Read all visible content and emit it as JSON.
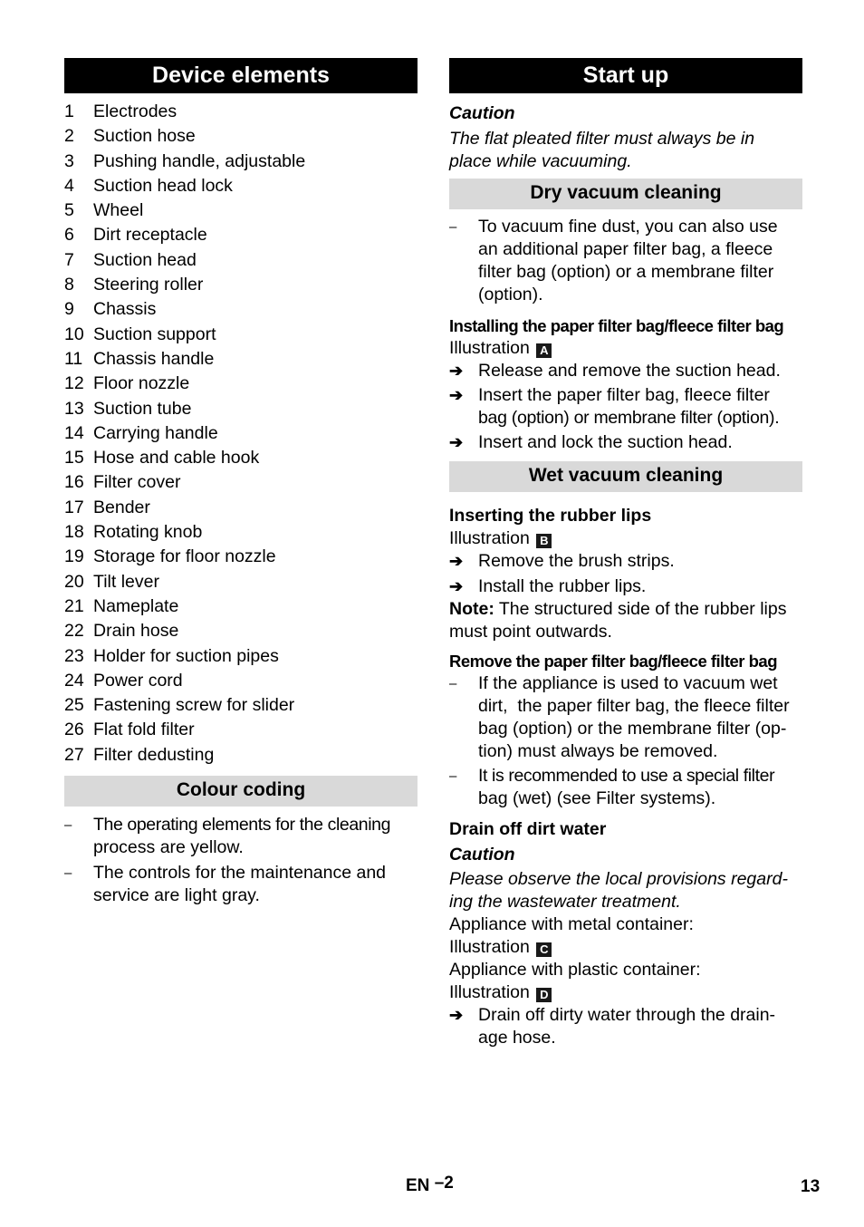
{
  "left": {
    "device_elements": {
      "title": "Device elements",
      "items": [
        {
          "n": "1",
          "label": "Electrodes"
        },
        {
          "n": "2",
          "label": "Suction hose"
        },
        {
          "n": "3",
          "label": "Pushing handle, adjustable"
        },
        {
          "n": "4",
          "label": "Suction head lock"
        },
        {
          "n": "5",
          "label": "Wheel"
        },
        {
          "n": "6",
          "label": "Dirt receptacle"
        },
        {
          "n": "7",
          "label": "Suction head"
        },
        {
          "n": "8",
          "label": "Steering roller"
        },
        {
          "n": "9",
          "label": "Chassis"
        },
        {
          "n": "10",
          "label": "Suction support"
        },
        {
          "n": "11",
          "label": "Chassis handle"
        },
        {
          "n": "12",
          "label": "Floor nozzle"
        },
        {
          "n": "13",
          "label": "Suction tube"
        },
        {
          "n": "14",
          "label": "Carrying handle"
        },
        {
          "n": "15",
          "label": "Hose and cable hook"
        },
        {
          "n": "16",
          "label": "Filter cover"
        },
        {
          "n": "17",
          "label": "Bender"
        },
        {
          "n": "18",
          "label": "Rotating knob"
        },
        {
          "n": "19",
          "label": "Storage for floor nozzle"
        },
        {
          "n": "20",
          "label": "Tilt lever"
        },
        {
          "n": "21",
          "label": "Nameplate"
        },
        {
          "n": "22",
          "label": "Drain hose"
        },
        {
          "n": "23",
          "label": "Holder for suction pipes"
        },
        {
          "n": "24",
          "label": "Power cord"
        },
        {
          "n": "25",
          "label": "Fastening screw for slider"
        },
        {
          "n": "26",
          "label": "Flat fold filter"
        },
        {
          "n": "27",
          "label": "Filter dedusting"
        }
      ]
    },
    "colour_coding": {
      "title": "Colour coding",
      "bullets": [
        {
          "line1": "The operating elements for the cleaning",
          "line2": "process are yellow."
        },
        {
          "line1": "The controls for the maintenance and",
          "line2": "service are light gray."
        }
      ]
    }
  },
  "right": {
    "title": "Start up",
    "caution_label": "Caution",
    "caution_text": [
      "The flat pleated filter must always be in",
      "place while vacuuming."
    ],
    "dry": {
      "title": "Dry vacuum cleaning",
      "bullet": [
        "To vacuum fine dust, you can also use",
        "an additional paper filter bag, a fleece",
        "filter bag (option) or a membrane filter",
        "(option)."
      ],
      "install_heading": "Installing the paper filter bag/fleece filter bag",
      "illustration_label": "Illustration",
      "illustration_letter": "A",
      "steps": [
        [
          "Release and remove the suction head."
        ],
        [
          "Insert the paper filter bag, fleece filter",
          "bag (option) or membrane filter (option)."
        ],
        [
          "Insert and lock the suction head."
        ]
      ]
    },
    "wet": {
      "title": "Wet vacuum cleaning",
      "rubber_heading": "Inserting the rubber lips",
      "illustration_label": "Illustration",
      "illustration_letter": "B",
      "steps": [
        "Remove the brush strips.",
        "Install the rubber lips."
      ],
      "note_label": "Note:",
      "note_text": " The structured side of the rubber lips",
      "note_text2": "must point outwards.",
      "remove_heading": "Remove the paper filter bag/fleece filter bag",
      "remove_bullets": [
        [
          "If the appliance is used to vacuum wet",
          "dirt,  the paper filter bag, the fleece filter",
          "bag (option) or the membrane filter (op-",
          "tion) must always be removed."
        ],
        [
          "It is recommended to use a special filter",
          "bag (wet) (see Filter systems)."
        ]
      ],
      "drain_heading": "Drain off dirt water",
      "caution_label": "Caution",
      "caution_text": [
        "Please observe the local provisions regard-",
        "ing the wastewater treatment."
      ],
      "metal_label": "Appliance with metal container:",
      "illustration_c_label": "Illustration",
      "illustration_c_letter": "C",
      "plastic_label": "Appliance with plastic container:",
      "illustration_d_label": "Illustration",
      "illustration_d_letter": "D",
      "drain_step": [
        "Drain off dirty water through the drain-",
        "age hose."
      ]
    }
  },
  "footer": {
    "lang": "EN",
    "dash": "–",
    "section": "2",
    "page_number": "13"
  },
  "icons": {
    "arrow": "➔",
    "dash": "–"
  }
}
